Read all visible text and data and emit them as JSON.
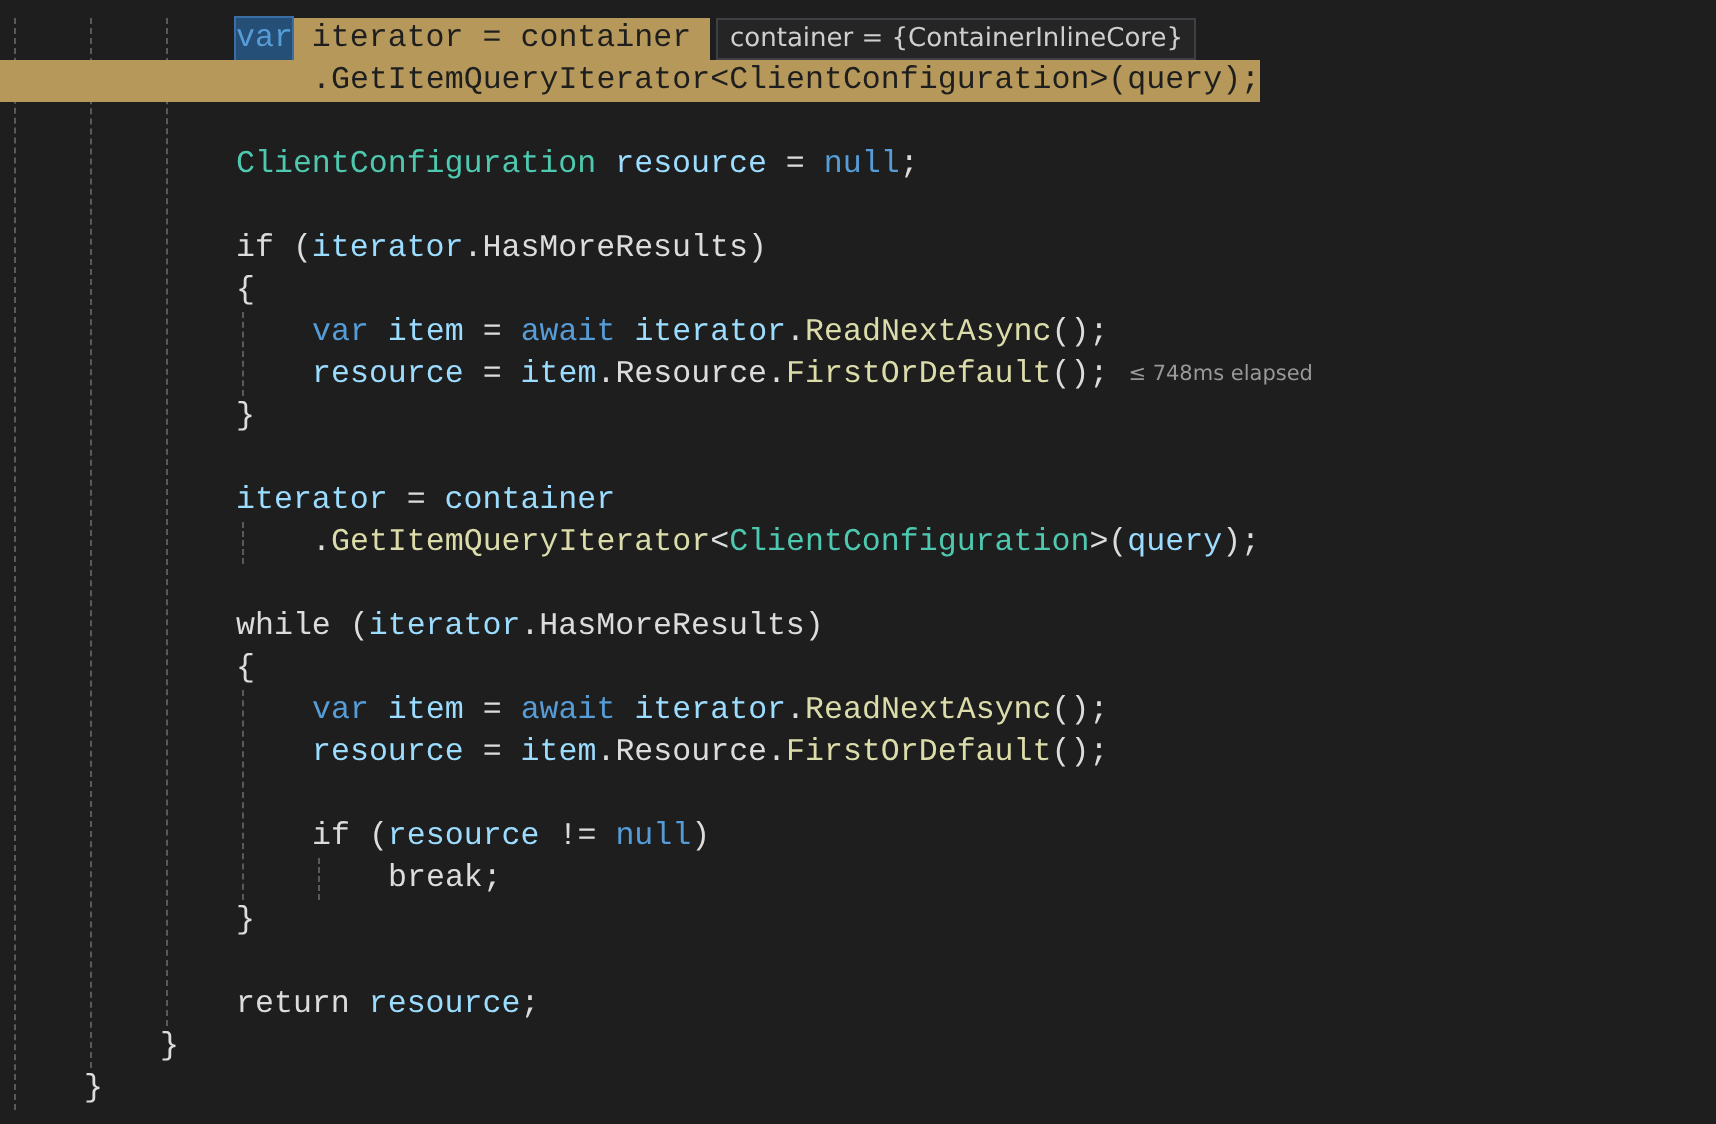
{
  "editor": {
    "lines": [
      {
        "kind": "group",
        "children": [
          {
            "kind": "group",
            "children": [
              {
                "kind": "code",
                "current": true,
                "datatip": "container = {ContainerInlineCore}",
                "tokens": [
                  {
                    "text": "var",
                    "kind": "keyword",
                    "selected": true
                  },
                  {
                    "text": " iterator",
                    "kind": "variable",
                    "selected": false
                  },
                  {
                    "text": " = ",
                    "kind": "plain",
                    "selected": false
                  },
                  {
                    "text": "container ",
                    "kind": "variable",
                    "selected": false
                  }
                ],
                "children": [
                  {
                    "kind": "code",
                    "current": true,
                    "tokens": [
                      {
                        "text": ".",
                        "kind": "plain"
                      },
                      {
                        "text": "GetItemQueryIterator",
                        "kind": "method"
                      },
                      {
                        "text": "<",
                        "kind": "plain"
                      },
                      {
                        "text": "ClientConfiguration",
                        "kind": "type"
                      },
                      {
                        "text": ">(",
                        "kind": "plain"
                      },
                      {
                        "text": "query",
                        "kind": "variable"
                      },
                      {
                        "text": ");",
                        "kind": "plain"
                      }
                    ]
                  }
                ]
              },
              {
                "kind": "blank"
              },
              {
                "kind": "code",
                "current": false,
                "tokens": [
                  {
                    "text": "ClientConfiguration",
                    "kind": "type"
                  },
                  {
                    "text": " resource",
                    "kind": "variable"
                  },
                  {
                    "text": " = ",
                    "kind": "plain"
                  },
                  {
                    "text": "null",
                    "kind": "keyword"
                  },
                  {
                    "text": ";",
                    "kind": "plain"
                  }
                ]
              },
              {
                "kind": "blank"
              },
              {
                "kind": "code",
                "current": false,
                "tokens": [
                  {
                    "text": "if (",
                    "kind": "control"
                  },
                  {
                    "text": "iterator",
                    "kind": "variable"
                  },
                  {
                    "text": ".HasMoreResults)",
                    "kind": "plain"
                  }
                ]
              },
              {
                "kind": "code",
                "current": false,
                "tokens": [
                  {
                    "text": "{",
                    "kind": "plain"
                  }
                ],
                "children": [
                  {
                    "kind": "code",
                    "current": false,
                    "tokens": [
                      {
                        "text": "var",
                        "kind": "keyword"
                      },
                      {
                        "text": " item",
                        "kind": "variable"
                      },
                      {
                        "text": " = ",
                        "kind": "plain"
                      },
                      {
                        "text": "await",
                        "kind": "keyword"
                      },
                      {
                        "text": " iterator",
                        "kind": "variable"
                      },
                      {
                        "text": ".",
                        "kind": "plain"
                      },
                      {
                        "text": "ReadNextAsync",
                        "kind": "method"
                      },
                      {
                        "text": "();",
                        "kind": "plain"
                      }
                    ]
                  },
                  {
                    "kind": "code",
                    "current": false,
                    "perf_tip": "≤ 748ms elapsed",
                    "tokens": [
                      {
                        "text": "resource",
                        "kind": "variable"
                      },
                      {
                        "text": " = ",
                        "kind": "plain"
                      },
                      {
                        "text": "item",
                        "kind": "variable"
                      },
                      {
                        "text": ".Resource.",
                        "kind": "plain"
                      },
                      {
                        "text": "FirstOrDefault",
                        "kind": "method"
                      },
                      {
                        "text": "();",
                        "kind": "plain"
                      }
                    ]
                  }
                ]
              },
              {
                "kind": "code",
                "current": false,
                "tokens": [
                  {
                    "text": "}",
                    "kind": "plain"
                  }
                ]
              },
              {
                "kind": "blank"
              },
              {
                "kind": "code",
                "current": false,
                "tokens": [
                  {
                    "text": "iterator",
                    "kind": "variable"
                  },
                  {
                    "text": " = ",
                    "kind": "plain"
                  },
                  {
                    "text": "container",
                    "kind": "variable"
                  }
                ],
                "children": [
                  {
                    "kind": "code",
                    "current": false,
                    "tokens": [
                      {
                        "text": ".",
                        "kind": "plain"
                      },
                      {
                        "text": "GetItemQueryIterator",
                        "kind": "method"
                      },
                      {
                        "text": "<",
                        "kind": "plain"
                      },
                      {
                        "text": "ClientConfiguration",
                        "kind": "type"
                      },
                      {
                        "text": ">(",
                        "kind": "plain"
                      },
                      {
                        "text": "query",
                        "kind": "variable"
                      },
                      {
                        "text": ");",
                        "kind": "plain"
                      }
                    ]
                  }
                ]
              },
              {
                "kind": "blank"
              },
              {
                "kind": "code",
                "current": false,
                "tokens": [
                  {
                    "text": "while (",
                    "kind": "control"
                  },
                  {
                    "text": "iterator",
                    "kind": "variable"
                  },
                  {
                    "text": ".HasMoreResults)",
                    "kind": "plain"
                  }
                ]
              },
              {
                "kind": "code",
                "current": false,
                "tokens": [
                  {
                    "text": "{",
                    "kind": "plain"
                  }
                ],
                "children": [
                  {
                    "kind": "code",
                    "current": false,
                    "tokens": [
                      {
                        "text": "var",
                        "kind": "keyword"
                      },
                      {
                        "text": " item",
                        "kind": "variable"
                      },
                      {
                        "text": " = ",
                        "kind": "plain"
                      },
                      {
                        "text": "await",
                        "kind": "keyword"
                      },
                      {
                        "text": " iterator",
                        "kind": "variable"
                      },
                      {
                        "text": ".",
                        "kind": "plain"
                      },
                      {
                        "text": "ReadNextAsync",
                        "kind": "method"
                      },
                      {
                        "text": "();",
                        "kind": "plain"
                      }
                    ]
                  },
                  {
                    "kind": "code",
                    "current": false,
                    "tokens": [
                      {
                        "text": "resource",
                        "kind": "variable"
                      },
                      {
                        "text": " = ",
                        "kind": "plain"
                      },
                      {
                        "text": "item",
                        "kind": "variable"
                      },
                      {
                        "text": ".Resource.",
                        "kind": "plain"
                      },
                      {
                        "text": "FirstOrDefault",
                        "kind": "method"
                      },
                      {
                        "text": "();",
                        "kind": "plain"
                      }
                    ]
                  },
                  {
                    "kind": "blank"
                  },
                  {
                    "kind": "code",
                    "current": false,
                    "tokens": [
                      {
                        "text": "if (",
                        "kind": "control"
                      },
                      {
                        "text": "resource",
                        "kind": "variable"
                      },
                      {
                        "text": " != ",
                        "kind": "plain"
                      },
                      {
                        "text": "null",
                        "kind": "keyword"
                      },
                      {
                        "text": ")",
                        "kind": "plain"
                      }
                    ],
                    "children": [
                      {
                        "kind": "code",
                        "current": false,
                        "tokens": [
                          {
                            "text": "break;",
                            "kind": "control"
                          }
                        ]
                      }
                    ]
                  }
                ]
              },
              {
                "kind": "code",
                "current": false,
                "tokens": [
                  {
                    "text": "}",
                    "kind": "plain"
                  }
                ]
              },
              {
                "kind": "blank"
              },
              {
                "kind": "code",
                "current": false,
                "tokens": [
                  {
                    "text": "return",
                    "kind": "control"
                  },
                  {
                    "text": " resource",
                    "kind": "variable"
                  },
                  {
                    "text": ";",
                    "kind": "plain"
                  }
                ]
              }
            ]
          },
          {
            "kind": "code",
            "current": false,
            "tokens": [
              {
                "text": "}",
                "kind": "plain"
              }
            ]
          }
        ]
      },
      {
        "kind": "code",
        "current": false,
        "tokens": [
          {
            "text": "}",
            "kind": "plain"
          }
        ]
      }
    ]
  }
}
